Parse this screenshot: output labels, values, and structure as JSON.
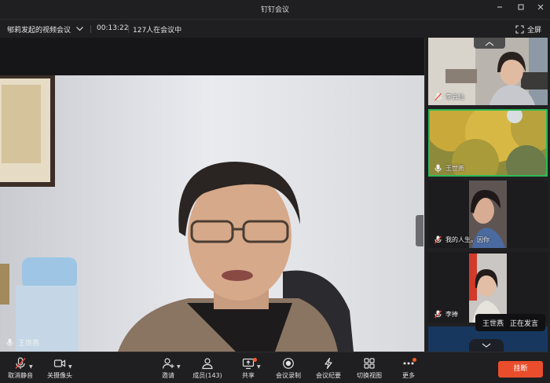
{
  "window": {
    "title": "钉钉会议"
  },
  "info": {
    "meeting_name": "郇莉发起的视频会议",
    "elapsed": "00:13:22",
    "participants_in_meeting": "127人在会议中",
    "fullscreen_label": "全屏"
  },
  "main_speaker": {
    "name": "王世燕",
    "mic": "on"
  },
  "participants": [
    {
      "name": "李云仙",
      "mic": "muted",
      "active": false
    },
    {
      "name": "王世燕",
      "mic": "on",
      "active": true
    },
    {
      "name": "我的人生。因你",
      "mic": "muted",
      "active": false
    },
    {
      "name": "李捧",
      "mic": "muted",
      "active": false
    }
  ],
  "speaking_toast": {
    "name": "王世燕",
    "status": "正在发言"
  },
  "toolbar": {
    "unmute": "取消静音",
    "camera_off": "关摄像头",
    "invite": "邀请",
    "members": "成员(143)",
    "share": "共享",
    "record": "会议录制",
    "minutes": "会议纪要",
    "switch_view": "切换视图",
    "more": "更多",
    "hangup": "挂断"
  },
  "colors": {
    "accent_active": "#2dbb56",
    "hangup": "#ea4d2b",
    "notification_dot": "#ff5a2a"
  }
}
